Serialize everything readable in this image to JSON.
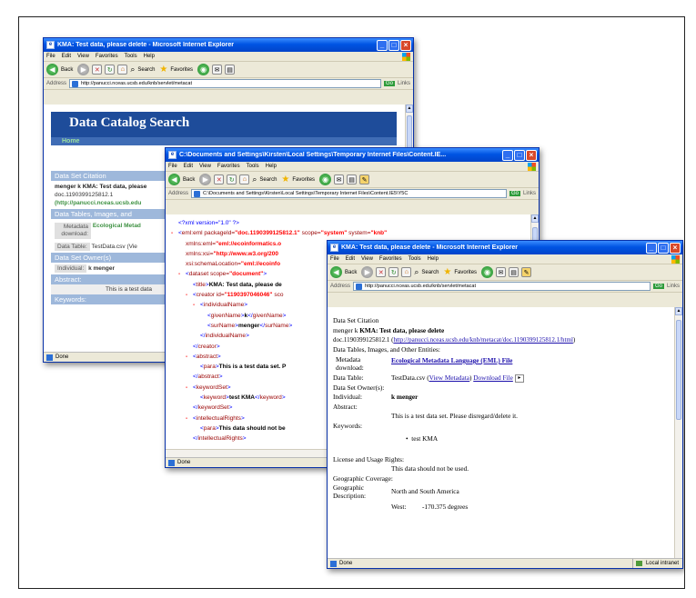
{
  "window1": {
    "title": "KMA: Test data, please delete - Microsoft Internet Explorer",
    "menu": [
      "File",
      "Edit",
      "View",
      "Favorites",
      "Tools",
      "Help"
    ],
    "toolbar": {
      "back": "Back",
      "search": "Search",
      "favorites": "Favorites"
    },
    "address": {
      "label": "Address",
      "url": "http://panucci.nceas.ucsb.edu/knb/servlet/metacat",
      "go": "Go",
      "links": "Links"
    },
    "content": {
      "header": "Data Catalog Search",
      "home": "Home",
      "citation_heading": "Data Set Citation",
      "citation_line1": "menger k KMA: Test data, please",
      "citation_line2": "doc.1190399125812.1",
      "citation_line3": "(http://panucci.nceas.ucsb.edu",
      "tables_heading": "Data Tables, Images, and",
      "metadata_label": "Metadata download:",
      "metadata_value": "Ecological Metad",
      "table_label": "Data Table:",
      "table_value": "TestData.csv (Vie",
      "owners_heading": "Data Set Owner(s)",
      "individual_label": "Individual:",
      "individual_value": "k menger",
      "abstract_heading": "Abstract:",
      "abstract_text": "This is a test data",
      "keywords_heading": "Keywords:"
    },
    "status": "Done"
  },
  "window2": {
    "title": "C:\\Documents and Settings\\Kirsten\\Local Settings\\Temporary Internet Files\\Content.IE...",
    "menu": [
      "File",
      "Edit",
      "View",
      "Favorites",
      "Tools",
      "Help"
    ],
    "toolbar": {
      "back": "Back",
      "search": "Search",
      "favorites": "Favorites"
    },
    "address": {
      "label": "Address",
      "url": "C:\\Documents and Settings\\Kirsten\\Local Settings\\Temporary Internet Files\\Content.IE5\\Y5C",
      "go": "Go",
      "links": "Links"
    },
    "xml": {
      "decl": "<?xml version=\"1.0\" ?>",
      "eml_open": "eml:eml",
      "package_attr": "packageId=",
      "package_val": "\"doc.1190399125812.1\"",
      "scope_attr": "scope=",
      "scope_val": "\"system\"",
      "system_attr": "system=",
      "system_val": "\"knb\"",
      "xmlns_eml_attr": "xmlns:eml=",
      "xmlns_eml_val": "\"eml://ecoinformatics.o",
      "xmlns_xsi_attr": "xmlns:xsi=",
      "xmlns_xsi_val": "\"http://www.w3.org/200",
      "schema_attr": "xsi:schemaLocation=",
      "schema_val": "\"eml://ecoinfo",
      "dataset_tag": "dataset",
      "dataset_attr": "scope=",
      "dataset_val": "\"document\"",
      "title_tag": "title",
      "title_text": "KMA: Test data, please de",
      "creator_tag": "creator",
      "creator_attr": "id=",
      "creator_val": "\"1190397046046\"",
      "creator_trail": "sco",
      "individual_tag": "individualName",
      "given_tag": "givenName",
      "given_text": "k",
      "sur_tag": "surName",
      "sur_text": "menger",
      "abstract_tag": "abstract",
      "para_tag": "para",
      "abstract_text": "This is a test data set. P",
      "keywordset_tag": "keywordSet",
      "keyword_tag": "keyword",
      "keyword_text": "test KMA",
      "rights_tag": "intellectualRights",
      "rights_text": "This data should not be"
    },
    "status": "Done"
  },
  "window3": {
    "title": "KMA: Test data, please delete - Microsoft Internet Explorer",
    "menu": [
      "File",
      "Edit",
      "View",
      "Favorites",
      "Tools",
      "Help"
    ],
    "toolbar": {
      "back": "Back",
      "search": "Search",
      "favorites": "Favorites"
    },
    "address": {
      "label": "Address",
      "url": "http://panucci.nceas.ucsb.edu/knb/servlet/metacat",
      "go": "Go",
      "links": "Links"
    },
    "doc": {
      "citation_heading": "Data Set Citation",
      "citation_author": "menger k",
      "citation_title": "KMA: Test data, please delete",
      "citation_doc": "doc.1190399125812.1 (",
      "citation_link": "http://panucci.nceas.ucsb.edu/knb/metacat/doc.1190399125812.1/html",
      "citation_close": ")",
      "tables_heading": "Data Tables, Images, and Other Entities:",
      "metadata_label1": "Metadata",
      "metadata_label2": "download:",
      "metadata_link": "Ecological Metadata Language (EML) File",
      "table_label": "Data Table:",
      "table_file": "TestData.csv (",
      "table_view": "View Metadata",
      "table_close": ")",
      "table_download": "Download File",
      "owners_heading": "Data Set Owner(s):",
      "individual_label": "Individual:",
      "individual_value": "k menger",
      "abstract_label": "Abstract:",
      "abstract_text": "This is a test data set. Please disregard/delete it.",
      "keywords_label": "Keywords:",
      "keyword1": "test KMA",
      "license_heading": "License and Usage Rights:",
      "license_text": "This data should not be used.",
      "geo_heading": "Geographic Coverage:",
      "geo_label1": "Geographic",
      "geo_label2": "Description:",
      "geo_value": "North and South America",
      "west_label": "West:",
      "west_value": "-170.375  degrees"
    },
    "status": "Done",
    "zone": "Local intranet"
  }
}
